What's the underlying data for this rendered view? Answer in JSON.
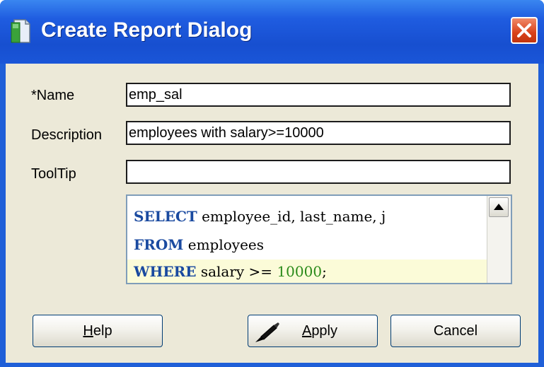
{
  "dialog": {
    "title": "Create Report Dialog",
    "title_icon": "report-icon",
    "close_icon": "close-icon"
  },
  "form": {
    "name_label": "*Name",
    "name_value": "emp_sal",
    "description_label": "Description",
    "description_value": "employees with salary>=10000",
    "tooltip_label": "ToolTip",
    "tooltip_value": ""
  },
  "sql": {
    "line1_kw": "SELECT",
    "line1_rest": " employee_id, last_name, j",
    "line2_kw": "FROM",
    "line2_rest": " employees",
    "line3_kw": "WHERE",
    "line3_rest": " salary >= ",
    "line3_num": "10000",
    "line3_end": ";"
  },
  "buttons": {
    "help_mnemonic": "H",
    "help_rest": "elp",
    "apply_mnemonic": "A",
    "apply_rest": "pply",
    "cancel": "Cancel"
  },
  "colors": {
    "titlebar": "#1f5ce0",
    "client": "#ece9d8",
    "keyword": "#1a4aa0",
    "number": "#2a8a1a",
    "current_line": "#fbfbd8"
  }
}
